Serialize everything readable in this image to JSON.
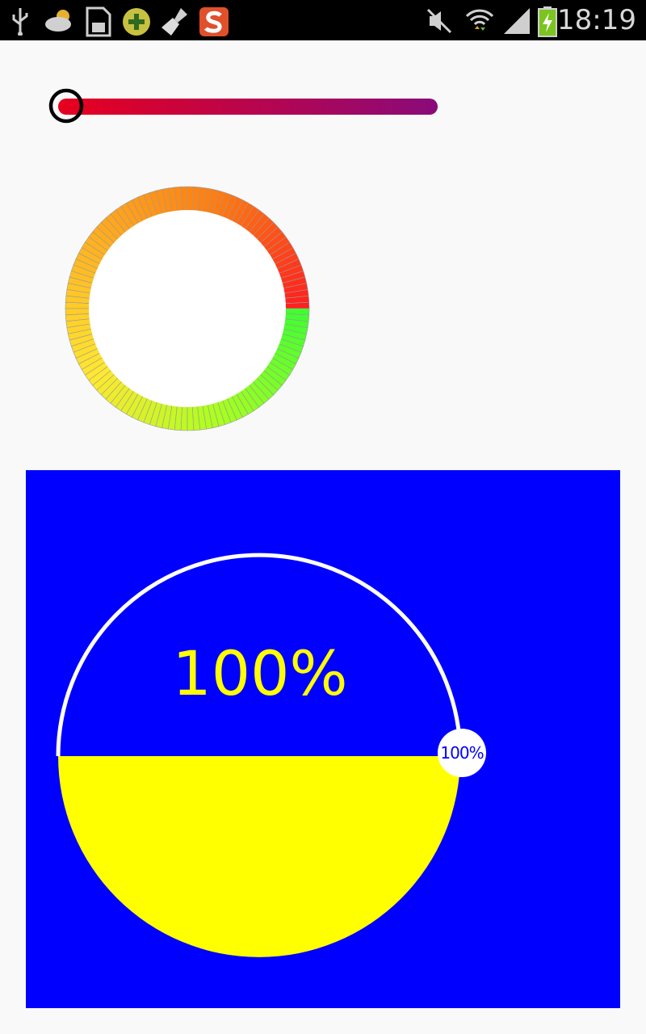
{
  "status_bar": {
    "time": "18:19",
    "icons": [
      "usb-icon",
      "weather-icon",
      "sd-card-icon",
      "app-plus-icon",
      "broom-icon",
      "s-app-icon",
      "mute-icon",
      "wifi-icon",
      "signal-icon",
      "battery-charging-icon"
    ]
  },
  "gradient_slider": {
    "value": 0,
    "colors": {
      "start": "#e8001e",
      "end": "#8a0a7a",
      "thumb_border": "#000000"
    }
  },
  "color_ring": {
    "gradient_colors": [
      "#ff2020",
      "#ff7a10",
      "#ffb020",
      "#ffe830",
      "#a8ff20",
      "#40ff30"
    ]
  },
  "wave_panel": {
    "percent_label": "100%",
    "badge_label": "100%",
    "fill_level": 0.5,
    "colors": {
      "background": "#0000ff",
      "fill": "#ffff00",
      "outline": "#ffffff",
      "text": "#ffff00"
    }
  }
}
